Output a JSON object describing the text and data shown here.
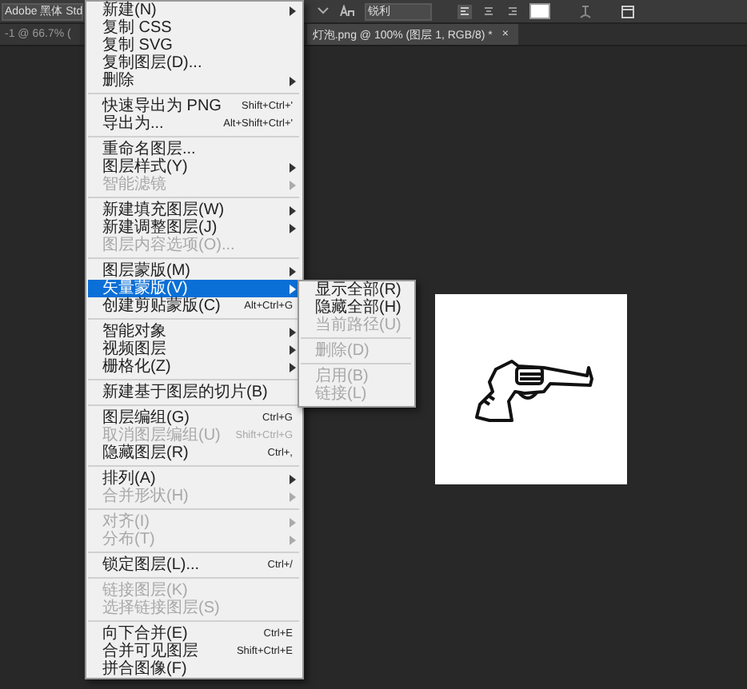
{
  "options_bar": {
    "font_family": "Adobe 黑体 Std",
    "antialias": "锐利"
  },
  "tabs": [
    {
      "label": "-1 @ 66.7% (",
      "selected": false
    },
    {
      "label": "灯泡.png @ 100% (图层 1, RGB/8) *",
      "close": "×",
      "selected": true
    }
  ],
  "menu": {
    "items": [
      {
        "kind": "item",
        "label": "新建(N)",
        "submenu": true,
        "disabled": false,
        "selected": false
      },
      {
        "kind": "item",
        "label": "复制 CSS",
        "disabled": false,
        "selected": false
      },
      {
        "kind": "item",
        "label": "复制 SVG",
        "disabled": false,
        "selected": false
      },
      {
        "kind": "item",
        "label": "复制图层(D)...",
        "disabled": false,
        "selected": false
      },
      {
        "kind": "item",
        "label": "删除",
        "submenu": true,
        "disabled": false,
        "selected": false
      },
      {
        "kind": "separator"
      },
      {
        "kind": "item",
        "label": "快速导出为 PNG",
        "shortcut": "Shift+Ctrl+'",
        "disabled": false,
        "selected": false
      },
      {
        "kind": "item",
        "label": "导出为...",
        "shortcut": "Alt+Shift+Ctrl+'",
        "disabled": false,
        "selected": false
      },
      {
        "kind": "separator"
      },
      {
        "kind": "item",
        "label": "重命名图层...",
        "disabled": false,
        "selected": false
      },
      {
        "kind": "item",
        "label": "图层样式(Y)",
        "submenu": true,
        "disabled": false,
        "selected": false
      },
      {
        "kind": "item",
        "label": "智能滤镜",
        "submenu": true,
        "disabled": true,
        "selected": false
      },
      {
        "kind": "separator"
      },
      {
        "kind": "item",
        "label": "新建填充图层(W)",
        "submenu": true,
        "disabled": false,
        "selected": false
      },
      {
        "kind": "item",
        "label": "新建调整图层(J)",
        "submenu": true,
        "disabled": false,
        "selected": false
      },
      {
        "kind": "item",
        "label": "图层内容选项(O)...",
        "disabled": true,
        "selected": false
      },
      {
        "kind": "separator"
      },
      {
        "kind": "item",
        "label": "图层蒙版(M)",
        "submenu": true,
        "disabled": false,
        "selected": false
      },
      {
        "kind": "item",
        "label": "矢量蒙版(V)",
        "submenu": true,
        "disabled": false,
        "selected": true
      },
      {
        "kind": "item",
        "label": "创建剪贴蒙版(C)",
        "shortcut": "Alt+Ctrl+G",
        "disabled": false,
        "selected": false
      },
      {
        "kind": "separator"
      },
      {
        "kind": "item",
        "label": "智能对象",
        "submenu": true,
        "disabled": false,
        "selected": false
      },
      {
        "kind": "item",
        "label": "视频图层",
        "submenu": true,
        "disabled": false,
        "selected": false
      },
      {
        "kind": "item",
        "label": "栅格化(Z)",
        "submenu": true,
        "disabled": false,
        "selected": false
      },
      {
        "kind": "separator"
      },
      {
        "kind": "item",
        "label": "新建基于图层的切片(B)",
        "disabled": false,
        "selected": false
      },
      {
        "kind": "separator"
      },
      {
        "kind": "item",
        "label": "图层编组(G)",
        "shortcut": "Ctrl+G",
        "disabled": false,
        "selected": false
      },
      {
        "kind": "item",
        "label": "取消图层编组(U)",
        "shortcut": "Shift+Ctrl+G",
        "disabled": true,
        "selected": false
      },
      {
        "kind": "item",
        "label": "隐藏图层(R)",
        "shortcut": "Ctrl+,",
        "disabled": false,
        "selected": false
      },
      {
        "kind": "separator"
      },
      {
        "kind": "item",
        "label": "排列(A)",
        "submenu": true,
        "disabled": false,
        "selected": false
      },
      {
        "kind": "item",
        "label": "合并形状(H)",
        "submenu": true,
        "disabled": true,
        "selected": false
      },
      {
        "kind": "separator"
      },
      {
        "kind": "item",
        "label": "对齐(I)",
        "submenu": true,
        "disabled": true,
        "selected": false
      },
      {
        "kind": "item",
        "label": "分布(T)",
        "submenu": true,
        "disabled": true,
        "selected": false
      },
      {
        "kind": "separator"
      },
      {
        "kind": "item",
        "label": "锁定图层(L)...",
        "shortcut": "Ctrl+/",
        "disabled": false,
        "selected": false
      },
      {
        "kind": "separator"
      },
      {
        "kind": "item",
        "label": "链接图层(K)",
        "disabled": true,
        "selected": false
      },
      {
        "kind": "item",
        "label": "选择链接图层(S)",
        "disabled": true,
        "selected": false
      },
      {
        "kind": "separator"
      },
      {
        "kind": "item",
        "label": "向下合并(E)",
        "shortcut": "Ctrl+E",
        "disabled": false,
        "selected": false
      },
      {
        "kind": "item",
        "label": "合并可见图层",
        "shortcut": "Shift+Ctrl+E",
        "disabled": false,
        "selected": false
      },
      {
        "kind": "item",
        "label": "拼合图像(F)",
        "disabled": false,
        "selected": false
      }
    ]
  },
  "submenu": {
    "items": [
      {
        "kind": "item",
        "label": "显示全部(R)",
        "disabled": false
      },
      {
        "kind": "item",
        "label": "隐藏全部(H)",
        "disabled": false
      },
      {
        "kind": "item",
        "label": "当前路径(U)",
        "disabled": true
      },
      {
        "kind": "separator"
      },
      {
        "kind": "item",
        "label": "删除(D)",
        "disabled": true
      },
      {
        "kind": "separator"
      },
      {
        "kind": "item",
        "label": "启用(B)",
        "disabled": true
      },
      {
        "kind": "item",
        "label": "链接(L)",
        "disabled": true
      }
    ]
  }
}
